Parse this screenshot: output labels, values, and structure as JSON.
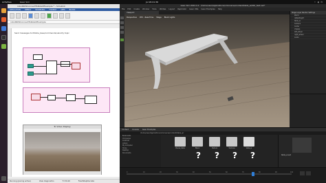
{
  "topbar": {
    "activities": "Activities",
    "app": "Isaac Sim",
    "clock": "Jul 26  01:36"
  },
  "simulink": {
    "title": "robotROSConnectToRobotExample * - Simulink",
    "tabs": [
      "SIMULATION",
      "DEBUG",
      "MODELING",
      "FORMAT",
      "APPS",
      "BLOCK"
    ],
    "breadcrumb": "robotROSConnectToRobotExample",
    "description": "Send messages to Mobile_base/commands/velocity topic",
    "copyright": "Copyright 2019-2022 The MathWorks, Inc.",
    "status_ready": "Running (pacing active)",
    "status_view": "View diagnostics",
    "status_time": "T=30.40",
    "status_solver": "FixedStepDiscrete"
  },
  "video": {
    "title": "To Video Display"
  },
  "isaac": {
    "title": "Isaac Sim 2022.1.0 - /home/user/Applications/omniverse/content/table_w/042_test.usd*",
    "menu": [
      "File",
      "Edit",
      "Create",
      "Window",
      "Tools",
      "Utilities",
      "Layout",
      "Replicator",
      "Isaac Utils",
      "Isaac Examples",
      "Help"
    ],
    "viewport_tab": "Viewport",
    "vp_toolbar": [
      "Perspective",
      "RTX - Real-Time",
      "Stage",
      "Black Lights"
    ],
    "right_tabs": "Stage  Layer  Render Settings",
    "stage_rows": [
      "World",
      "defaultLight",
      "table_w",
      "Camera",
      "Carter",
      "chassis",
      "left_wheel",
      "right_wheel",
      "Looks"
    ],
    "content_tabs": [
      "Content",
      "Console",
      "Isaac Examples"
    ],
    "path": "/home/user/Applications/omniverse/content/table_w/",
    "folders": [
      "Bookmarks",
      "Omniverse",
      "localhost",
      "Library",
      "My Computer",
      "Home",
      "Desktop",
      "Documents"
    ],
    "assets": [
      "Pieces_table",
      "Blank",
      "Texture",
      "Textures",
      "table_w",
      "table_w_v2",
      "x_test",
      "y_test"
    ],
    "detail_title": "table_w.usd",
    "timeline_ticks": [
      "0",
      "10",
      "20",
      "30",
      "40",
      "50",
      "60",
      "70",
      "80",
      "90",
      "100"
    ]
  }
}
